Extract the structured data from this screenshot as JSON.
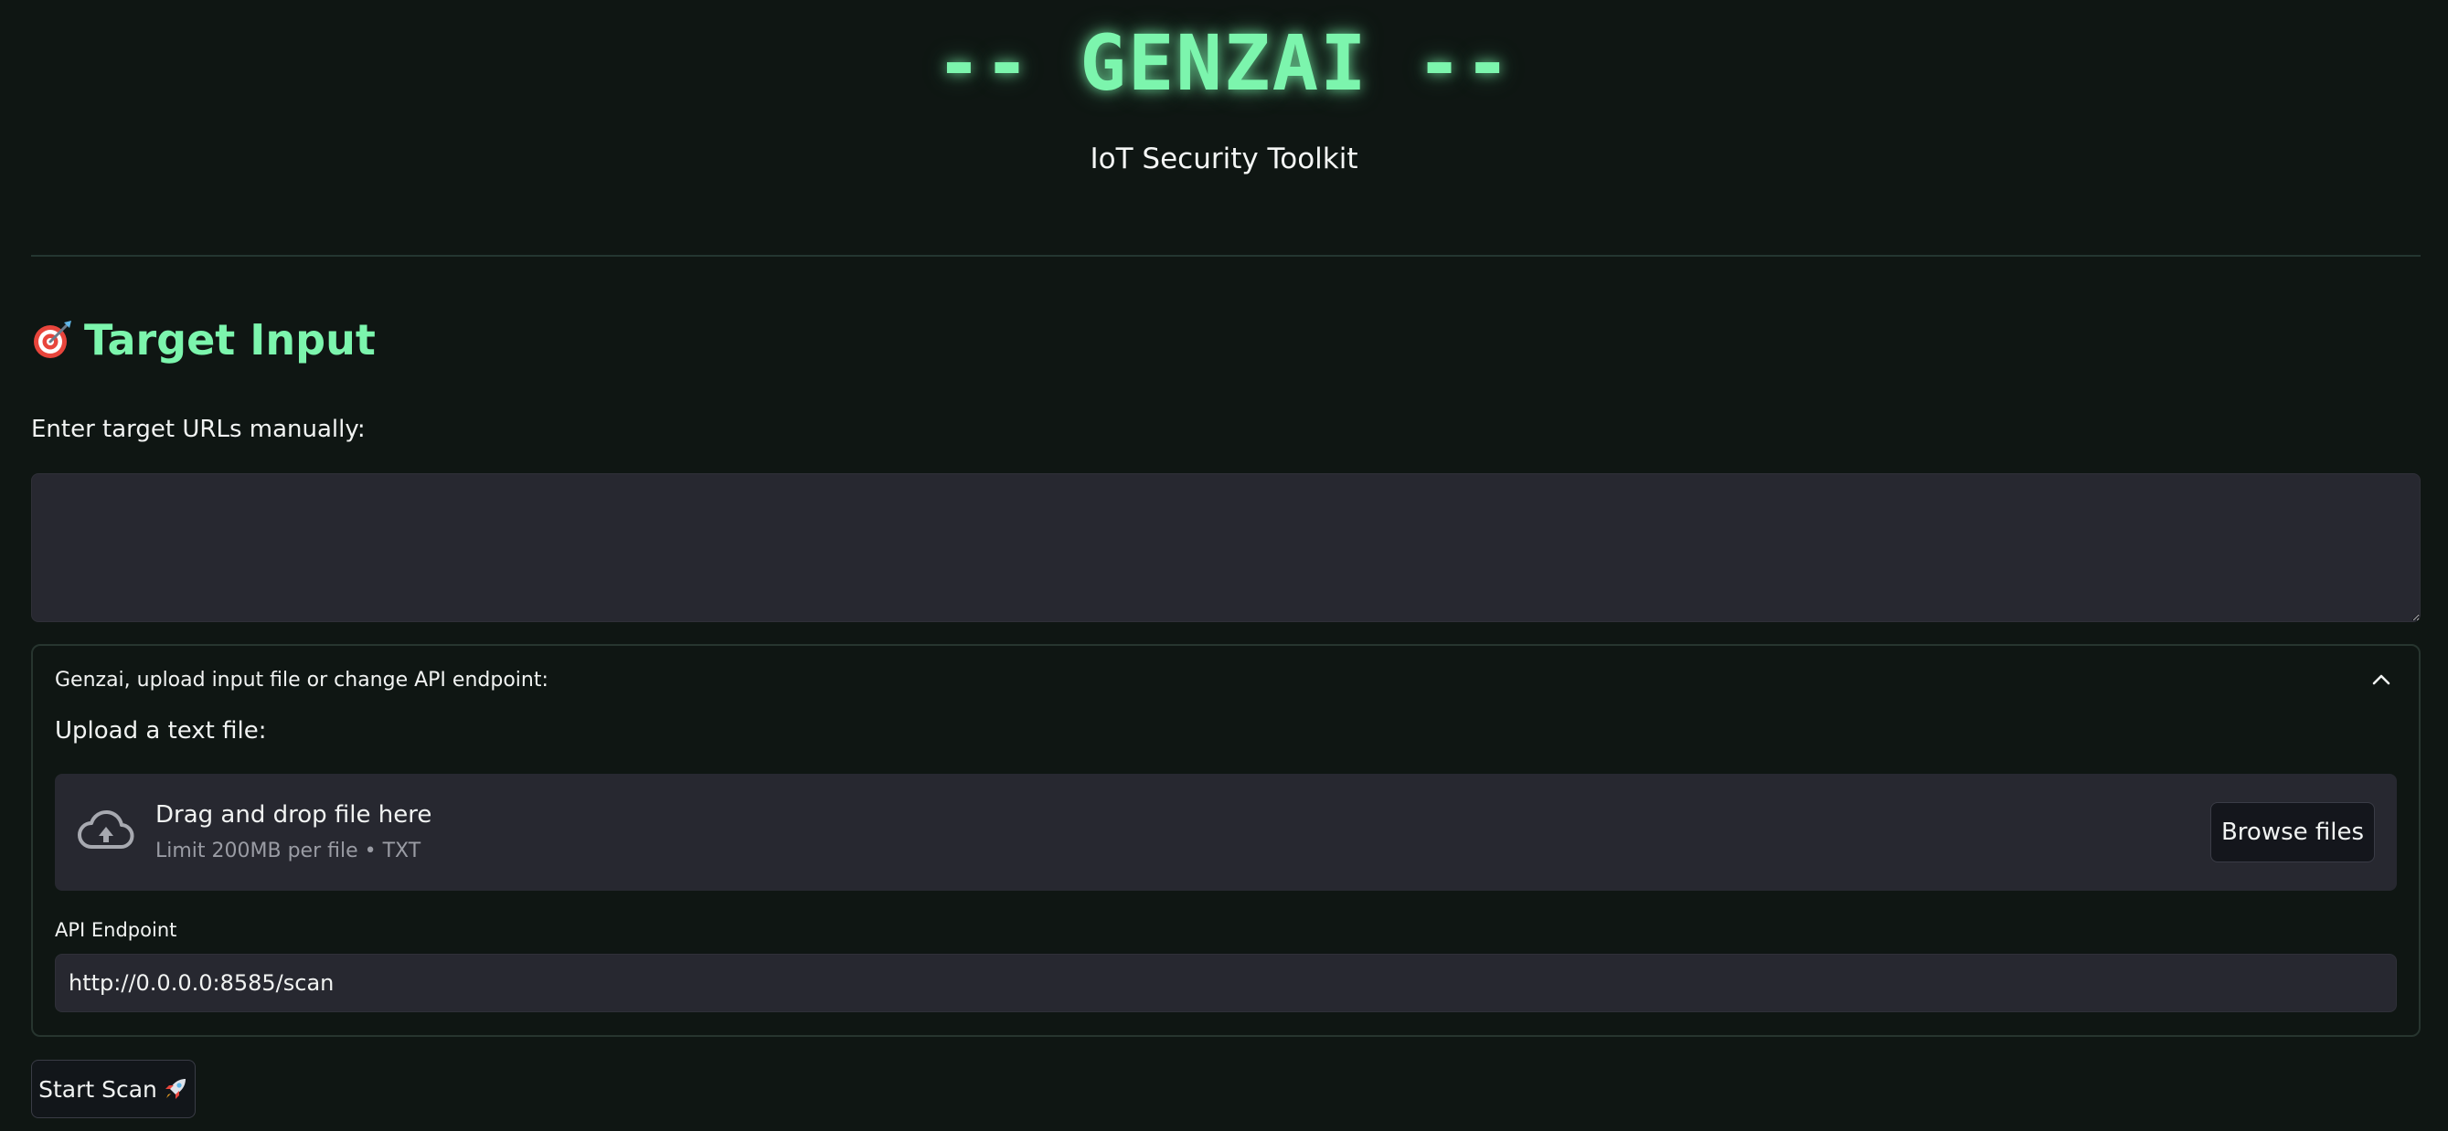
{
  "header": {
    "title": "-- GENZAI --",
    "subtitle": "IoT Security Toolkit"
  },
  "target_input": {
    "heading_icon": "dart-target-icon",
    "heading": "Target Input",
    "manual_label": "Enter target URLs manually:",
    "textarea_value": ""
  },
  "expander": {
    "title": "Genzai, upload input file or change API endpoint:",
    "expanded": true,
    "toggle_icon": "chevron-up-icon",
    "upload": {
      "label": "Upload a text file:",
      "icon": "cloud-upload-icon",
      "drop_title": "Drag and drop file here",
      "drop_limit": "Limit 200MB per file • TXT",
      "browse_label": "Browse files"
    },
    "api": {
      "label": "API Endpoint",
      "value": "http://0.0.0.0:8585/scan"
    }
  },
  "actions": {
    "start_label": "Start Scan",
    "start_icon": "rocket-icon"
  },
  "colors": {
    "background": "#0f1613",
    "accent": "#7cf5ad",
    "input_bg": "#272830",
    "border": "#27352f"
  }
}
